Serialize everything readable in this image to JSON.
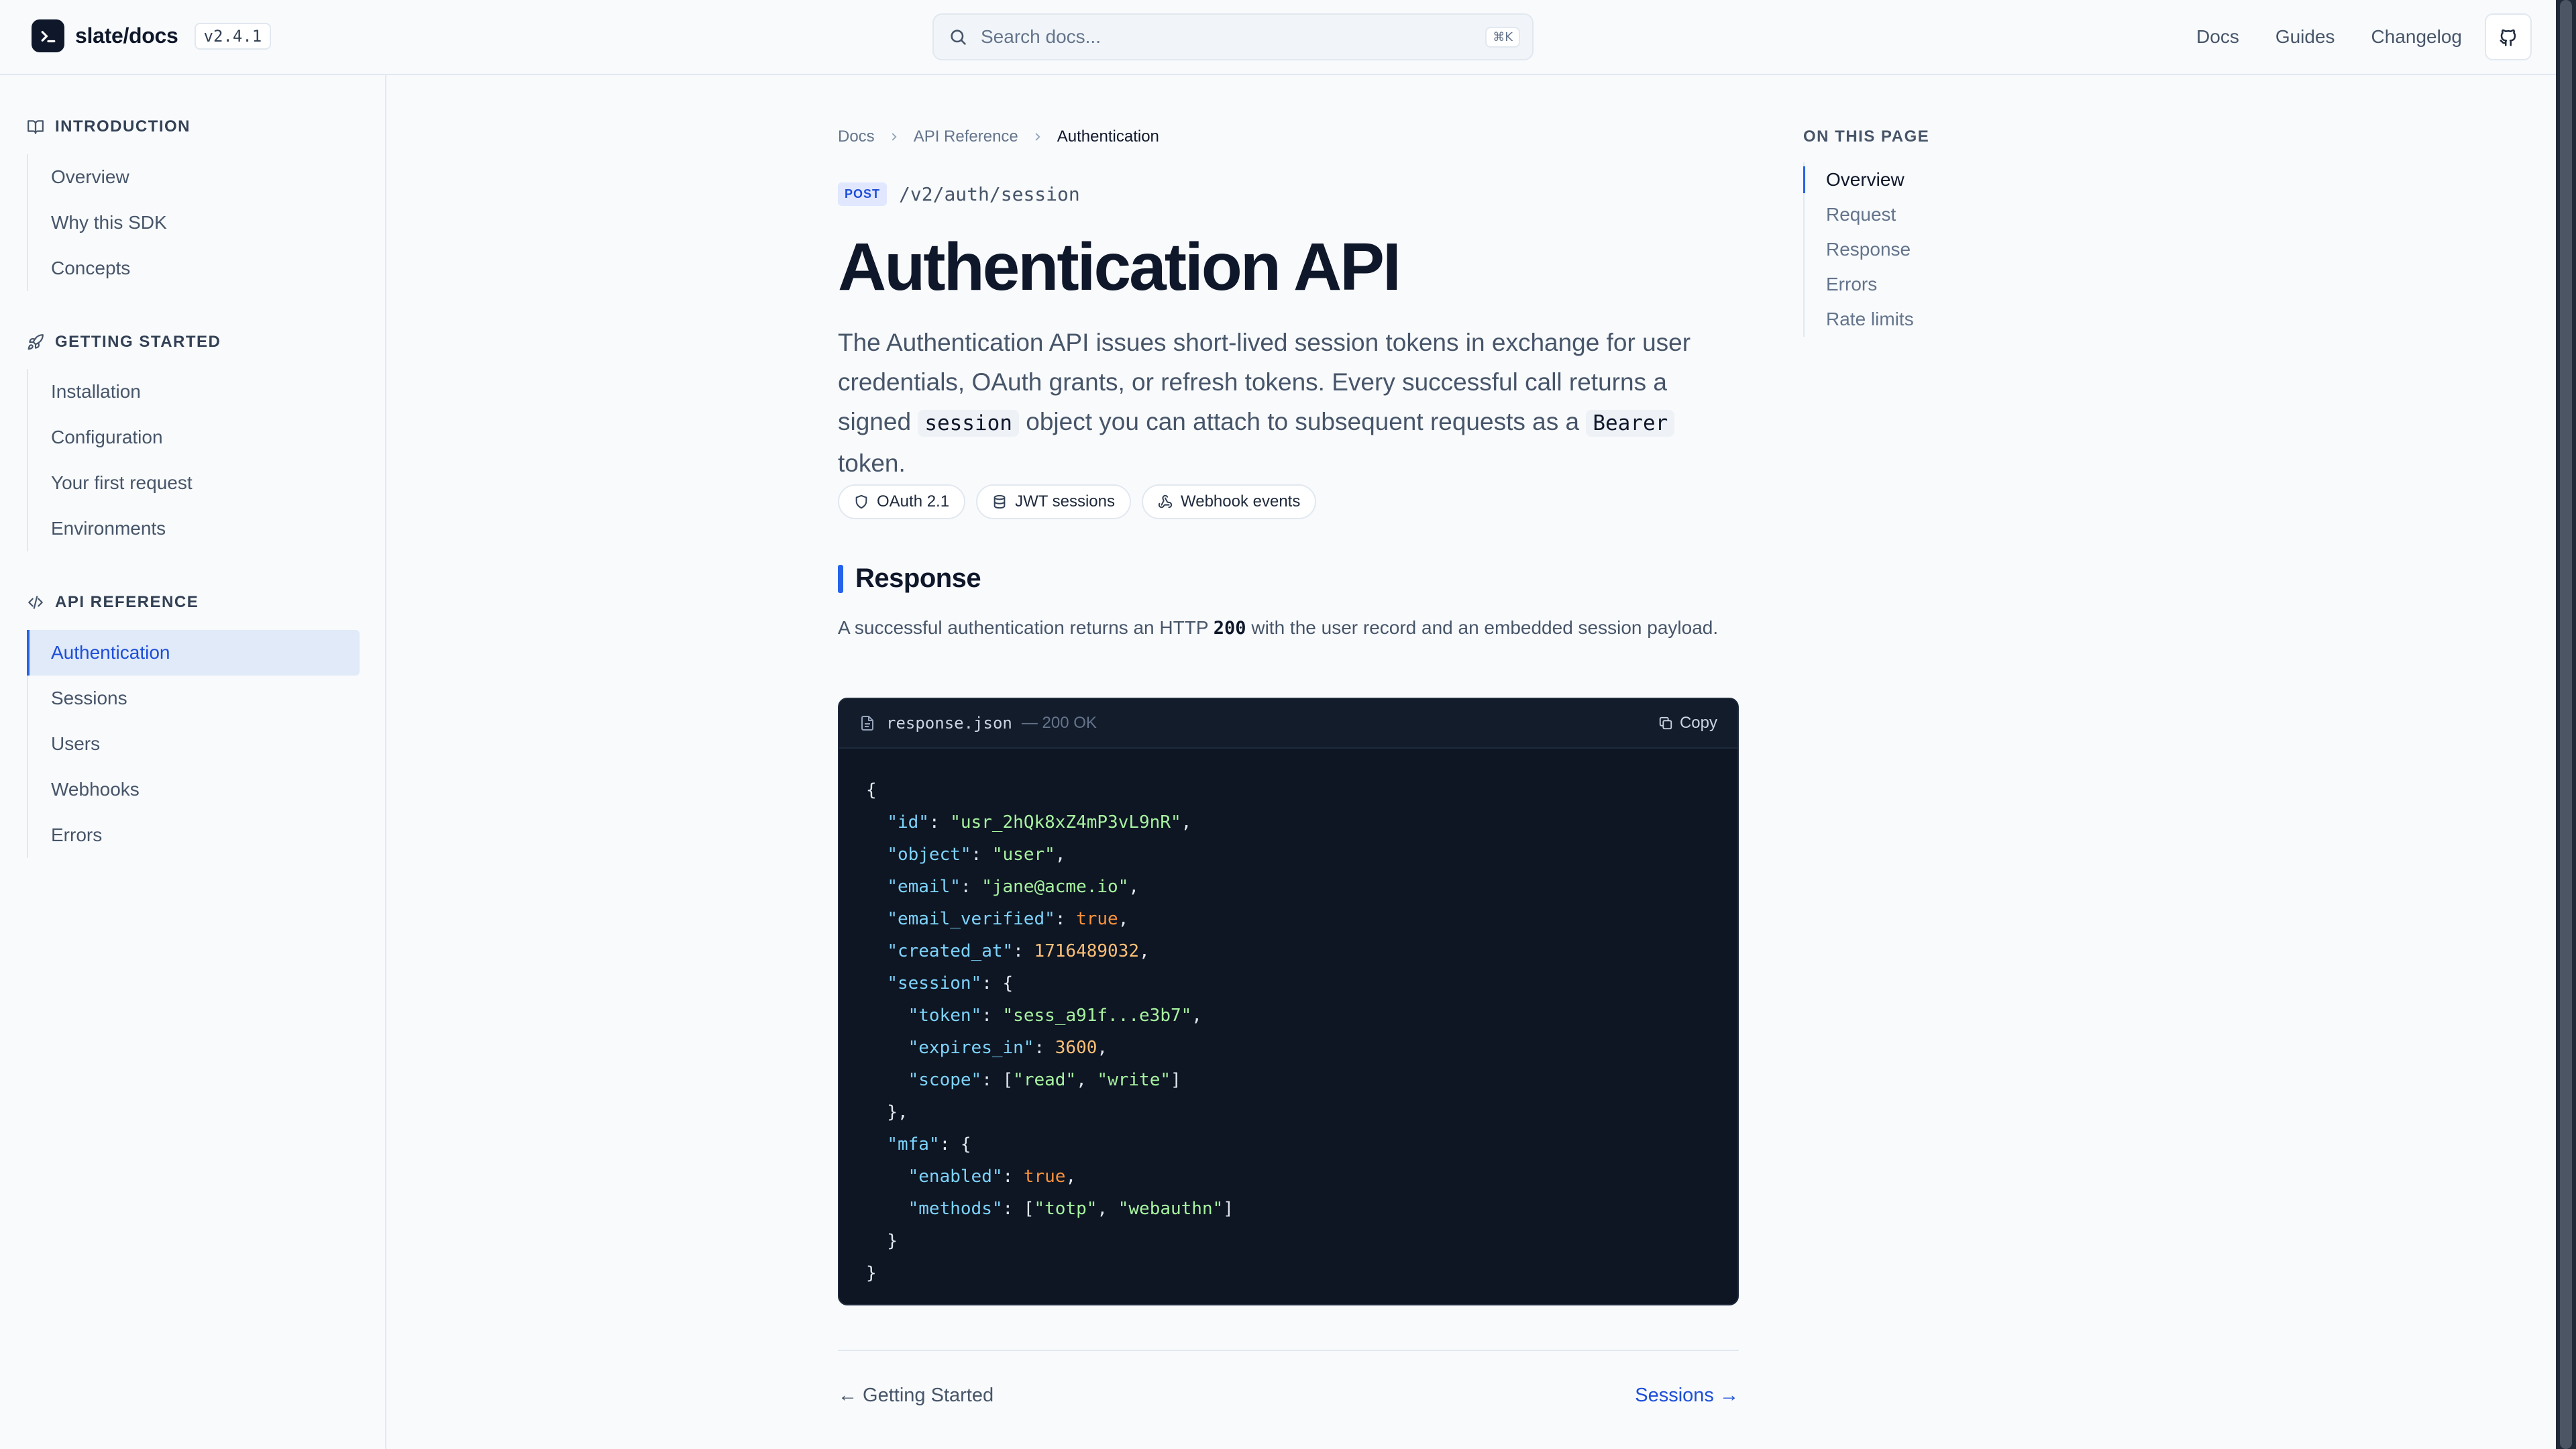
{
  "brand": {
    "name": "slate/docs",
    "version": "v2.4.1"
  },
  "search": {
    "placeholder": "Search docs...",
    "shortcut": "⌘K"
  },
  "topnav": {
    "docs": "Docs",
    "guides": "Guides",
    "changelog": "Changelog"
  },
  "sidebar": {
    "sections": [
      {
        "title": "INTRODUCTION",
        "icon": "book-icon",
        "items": [
          "Overview",
          "Why this SDK",
          "Concepts"
        ]
      },
      {
        "title": "GETTING STARTED",
        "icon": "rocket-icon",
        "items": [
          "Installation",
          "Configuration",
          "Your first request",
          "Environments"
        ]
      },
      {
        "title": "API REFERENCE",
        "icon": "code-icon",
        "items": [
          "Authentication",
          "Sessions",
          "Users",
          "Webhooks",
          "Errors"
        ]
      }
    ],
    "active_item": "Authentication"
  },
  "breadcrumb": [
    "Docs",
    "API Reference",
    "Authentication"
  ],
  "endpoint": {
    "method": "POST",
    "path": "/v2/auth/session"
  },
  "page": {
    "title": "Authentication API",
    "lead": {
      "part1": "The Authentication API issues short-lived session tokens in exchange for user credentials, OAuth grants, or refresh tokens. Every successful call returns a signed ",
      "code1": "session",
      "part2": " object you can attach to subsequent requests as a ",
      "code2": "Bearer",
      "part3": " token."
    },
    "chips": [
      {
        "label": "OAuth 2.1",
        "icon": "shield-icon"
      },
      {
        "label": "JWT sessions",
        "icon": "database-icon"
      },
      {
        "label": "Webhook events",
        "icon": "webhook-icon"
      }
    ]
  },
  "response_section": {
    "heading": "Response",
    "text1": "A successful authentication returns an HTTP ",
    "code": "200",
    "text2": " with the user record and an embedded session payload."
  },
  "codeblock": {
    "filename": "response.json",
    "status": "— 200 OK",
    "copy_label": "Copy",
    "json": {
      "id": "usr_2hQk8xZ4mP3vL9nR",
      "object": "user",
      "email": "jane@acme.io",
      "email_verified": "true",
      "created_at": "1716489032",
      "session_token": "sess_a91f...e3b7",
      "session_expires_in": "3600",
      "session_scope": [
        "read",
        "write"
      ],
      "mfa_enabled": "true",
      "mfa_methods": [
        "totp",
        "webauthn"
      ]
    }
  },
  "pager": {
    "prev": "← Getting Started",
    "next": "Sessions →"
  },
  "toc": {
    "title": "ON THIS PAGE",
    "items": [
      "Overview",
      "Request",
      "Response",
      "Errors",
      "Rate limits"
    ],
    "active": "Overview"
  },
  "colors": {
    "accent": "#2563eb",
    "code_bg": "#0e1623",
    "ink": "#0f172a"
  }
}
